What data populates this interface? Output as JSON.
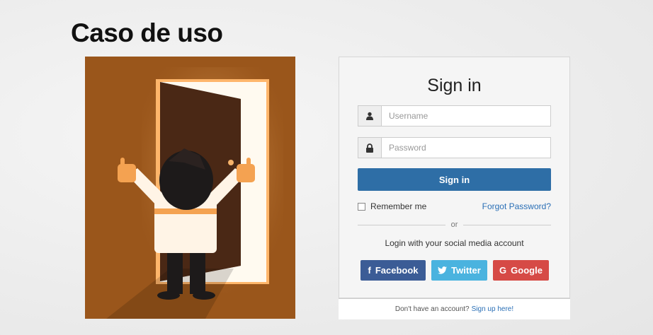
{
  "slide": {
    "title": "Caso de uso"
  },
  "login": {
    "title": "Sign in",
    "username_placeholder": "Username",
    "password_placeholder": "Password",
    "signin_button": "Sign in",
    "remember_label": "Remember me",
    "remember_checked": false,
    "forgot_link": "Forgot Password?",
    "divider_text": "or",
    "social_text": "Login with your social media account",
    "social": [
      {
        "label": "Facebook",
        "icon": "facebook-icon",
        "color": "#3b5c96"
      },
      {
        "label": "Twitter",
        "icon": "twitter-icon",
        "color": "#4ab3df"
      },
      {
        "label": "Google",
        "icon": "google-icon",
        "color": "#d64a46"
      }
    ],
    "footer_text": "Don't have an account?",
    "footer_link": "Sign up here!"
  },
  "colors": {
    "primary": "#2e6ea6",
    "link": "#2a6fb6",
    "illustration_bg": "#9a561b"
  }
}
